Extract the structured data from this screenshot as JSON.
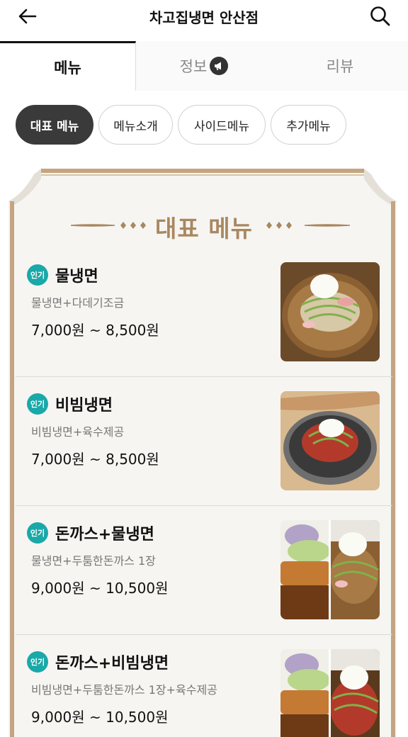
{
  "header": {
    "title": "차고집냉면 안산점",
    "back_icon": "arrow-left-icon",
    "search_icon": "search-icon"
  },
  "tabs": [
    {
      "label": "메뉴",
      "active": true
    },
    {
      "label": "정보",
      "active": false,
      "icon": "megaphone-icon"
    },
    {
      "label": "리뷰",
      "active": false
    }
  ],
  "chips": [
    {
      "label": "대표 메뉴",
      "active": true
    },
    {
      "label": "메뉴소개",
      "active": false
    },
    {
      "label": "사이드메뉴",
      "active": false
    },
    {
      "label": "추가메뉴",
      "active": false
    }
  ],
  "section": {
    "title": "대표 메뉴"
  },
  "menu_items": [
    {
      "badge": "인기",
      "name": "물냉면",
      "desc": "물냉면+다데기조금",
      "price": "7,000원 ~ 8,500원",
      "image": "mul-naengmyeon-photo"
    },
    {
      "badge": "인기",
      "name": "비빔냉면",
      "desc": "비빔냉면+육수제공",
      "price": "7,000원 ~ 8,500원",
      "image": "bibim-naengmyeon-photo"
    },
    {
      "badge": "인기",
      "name": "돈까스+물냉면",
      "desc": "물냉면+두툼한돈까스 1장",
      "price": "9,000원 ~ 10,500원",
      "image": "donkatsu-mul-naengmyeon-photo"
    },
    {
      "badge": "인기",
      "name": "돈까스+비빔냉면",
      "desc": "비빔냉면+두툼한돈까스 1장+육수제공",
      "price": "9,000원 ~ 10,500원",
      "image": "donkatsu-bibim-naengmyeon-photo"
    }
  ],
  "colors": {
    "accent_gold": "#a98760",
    "popular_badge": "#1aa8a8",
    "chip_active": "#3a3a3a"
  }
}
